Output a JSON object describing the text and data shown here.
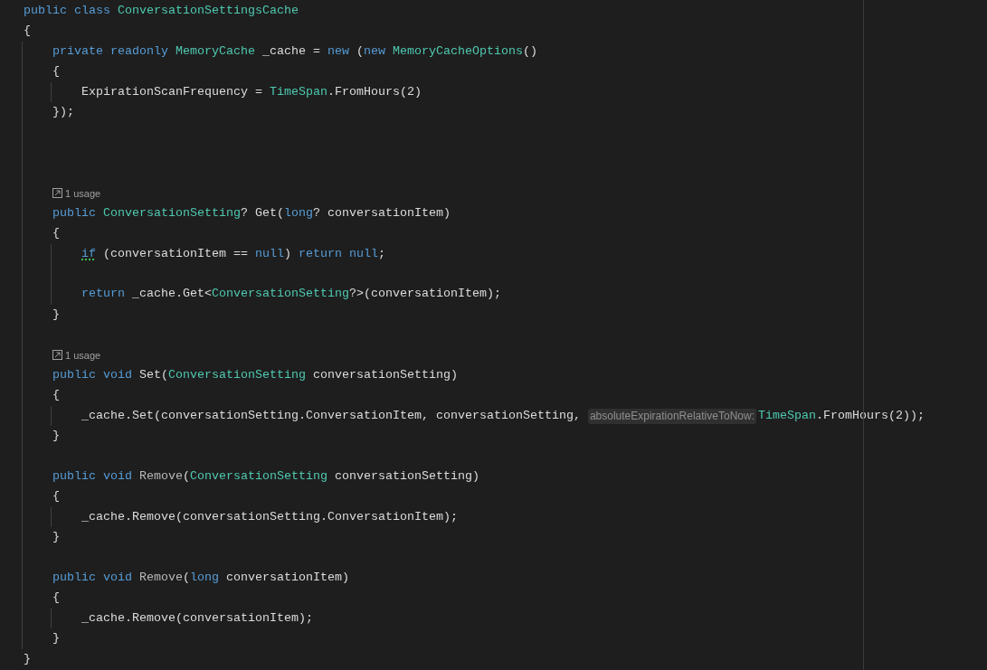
{
  "editor": {
    "lines": [
      {
        "kind": "code",
        "tokens": [
          {
            "kind": "keyword",
            "text": "public class "
          },
          {
            "kind": "type",
            "text": "ConversationSettingsCache"
          }
        ]
      },
      {
        "kind": "code",
        "tokens": [
          {
            "kind": "plain",
            "text": "{"
          }
        ]
      },
      {
        "kind": "block",
        "children": [
          {
            "kind": "code",
            "tokens": [
              {
                "kind": "keyword",
                "text": "private readonly "
              },
              {
                "kind": "type",
                "text": "MemoryCache"
              },
              {
                "kind": "plain",
                "text": " _cache = "
              },
              {
                "kind": "keyword",
                "text": "new"
              },
              {
                "kind": "plain",
                "text": " ("
              },
              {
                "kind": "keyword",
                "text": "new "
              },
              {
                "kind": "type",
                "text": "MemoryCacheOptions"
              },
              {
                "kind": "plain",
                "text": "()"
              }
            ]
          },
          {
            "kind": "code",
            "tokens": [
              {
                "kind": "plain",
                "text": "{"
              }
            ]
          },
          {
            "kind": "block",
            "children": [
              {
                "kind": "code",
                "tokens": [
                  {
                    "kind": "plain",
                    "text": "ExpirationScanFrequency = "
                  },
                  {
                    "kind": "type",
                    "text": "TimeSpan"
                  },
                  {
                    "kind": "plain",
                    "text": ".FromHours(2)"
                  }
                ]
              }
            ]
          },
          {
            "kind": "code",
            "tokens": [
              {
                "kind": "plain",
                "text": "});"
              }
            ]
          },
          {
            "kind": "blank"
          },
          {
            "kind": "blank"
          },
          {
            "kind": "blank"
          },
          {
            "kind": "codelens",
            "text": "1 usage"
          },
          {
            "kind": "code",
            "tokens": [
              {
                "kind": "keyword",
                "text": "public "
              },
              {
                "kind": "type",
                "text": "ConversationSetting"
              },
              {
                "kind": "plain",
                "text": "? Get("
              },
              {
                "kind": "keyword",
                "text": "long"
              },
              {
                "kind": "plain",
                "text": "? conversationItem)"
              }
            ]
          },
          {
            "kind": "code",
            "tokens": [
              {
                "kind": "plain",
                "text": "{"
              }
            ]
          },
          {
            "kind": "block",
            "children": [
              {
                "kind": "code",
                "tokens": [
                  {
                    "kind": "warned-keyword",
                    "text": "if"
                  },
                  {
                    "kind": "plain",
                    "text": " (conversationItem == "
                  },
                  {
                    "kind": "keyword",
                    "text": "null"
                  },
                  {
                    "kind": "plain",
                    "text": ") "
                  },
                  {
                    "kind": "keyword",
                    "text": "return null"
                  },
                  {
                    "kind": "plain",
                    "text": ";"
                  }
                ]
              },
              {
                "kind": "blank"
              },
              {
                "kind": "code",
                "tokens": [
                  {
                    "kind": "keyword",
                    "text": "return"
                  },
                  {
                    "kind": "plain",
                    "text": " _cache.Get<"
                  },
                  {
                    "kind": "type",
                    "text": "ConversationSetting"
                  },
                  {
                    "kind": "plain",
                    "text": "?>(conversationItem);"
                  }
                ]
              }
            ]
          },
          {
            "kind": "code",
            "tokens": [
              {
                "kind": "plain",
                "text": "}"
              }
            ]
          },
          {
            "kind": "blank"
          },
          {
            "kind": "codelens",
            "text": "1 usage"
          },
          {
            "kind": "code",
            "tokens": [
              {
                "kind": "keyword",
                "text": "public void "
              },
              {
                "kind": "plain",
                "text": "Set("
              },
              {
                "kind": "type",
                "text": "ConversationSetting"
              },
              {
                "kind": "plain",
                "text": " conversationSetting)"
              }
            ]
          },
          {
            "kind": "code",
            "tokens": [
              {
                "kind": "plain",
                "text": "{"
              }
            ]
          },
          {
            "kind": "block",
            "children": [
              {
                "kind": "code",
                "tokens": [
                  {
                    "kind": "plain",
                    "text": "_cache.Set(conversationSetting.ConversationItem, conversationSetting, "
                  },
                  {
                    "kind": "hint",
                    "text": "absoluteExpirationRelativeToNow:"
                  },
                  {
                    "kind": "type",
                    "text": "TimeSpan"
                  },
                  {
                    "kind": "plain",
                    "text": ".FromHours(2));"
                  }
                ]
              }
            ]
          },
          {
            "kind": "code",
            "tokens": [
              {
                "kind": "plain",
                "text": "}"
              }
            ]
          },
          {
            "kind": "blank"
          },
          {
            "kind": "code",
            "tokens": [
              {
                "kind": "keyword",
                "text": "public void "
              },
              {
                "kind": "dim",
                "text": "Remove"
              },
              {
                "kind": "plain",
                "text": "("
              },
              {
                "kind": "type",
                "text": "ConversationSetting"
              },
              {
                "kind": "plain",
                "text": " conversationSetting)"
              }
            ]
          },
          {
            "kind": "code",
            "tokens": [
              {
                "kind": "plain",
                "text": "{"
              }
            ]
          },
          {
            "kind": "block",
            "children": [
              {
                "kind": "code",
                "tokens": [
                  {
                    "kind": "plain",
                    "text": "_cache.Remove(conversationSetting.ConversationItem);"
                  }
                ]
              }
            ]
          },
          {
            "kind": "code",
            "tokens": [
              {
                "kind": "plain",
                "text": "}"
              }
            ]
          },
          {
            "kind": "blank"
          },
          {
            "kind": "code",
            "tokens": [
              {
                "kind": "keyword",
                "text": "public void "
              },
              {
                "kind": "dim",
                "text": "Remove"
              },
              {
                "kind": "plain",
                "text": "("
              },
              {
                "kind": "keyword",
                "text": "long"
              },
              {
                "kind": "plain",
                "text": " conversationItem)"
              }
            ]
          },
          {
            "kind": "code",
            "tokens": [
              {
                "kind": "plain",
                "text": "{"
              }
            ]
          },
          {
            "kind": "block",
            "children": [
              {
                "kind": "code",
                "tokens": [
                  {
                    "kind": "plain",
                    "text": "_cache.Remove(conversationItem);"
                  }
                ]
              }
            ]
          },
          {
            "kind": "code",
            "tokens": [
              {
                "kind": "plain",
                "text": "}"
              }
            ]
          }
        ]
      },
      {
        "kind": "code",
        "tokens": [
          {
            "kind": "plain",
            "text": "}"
          }
        ]
      }
    ]
  }
}
